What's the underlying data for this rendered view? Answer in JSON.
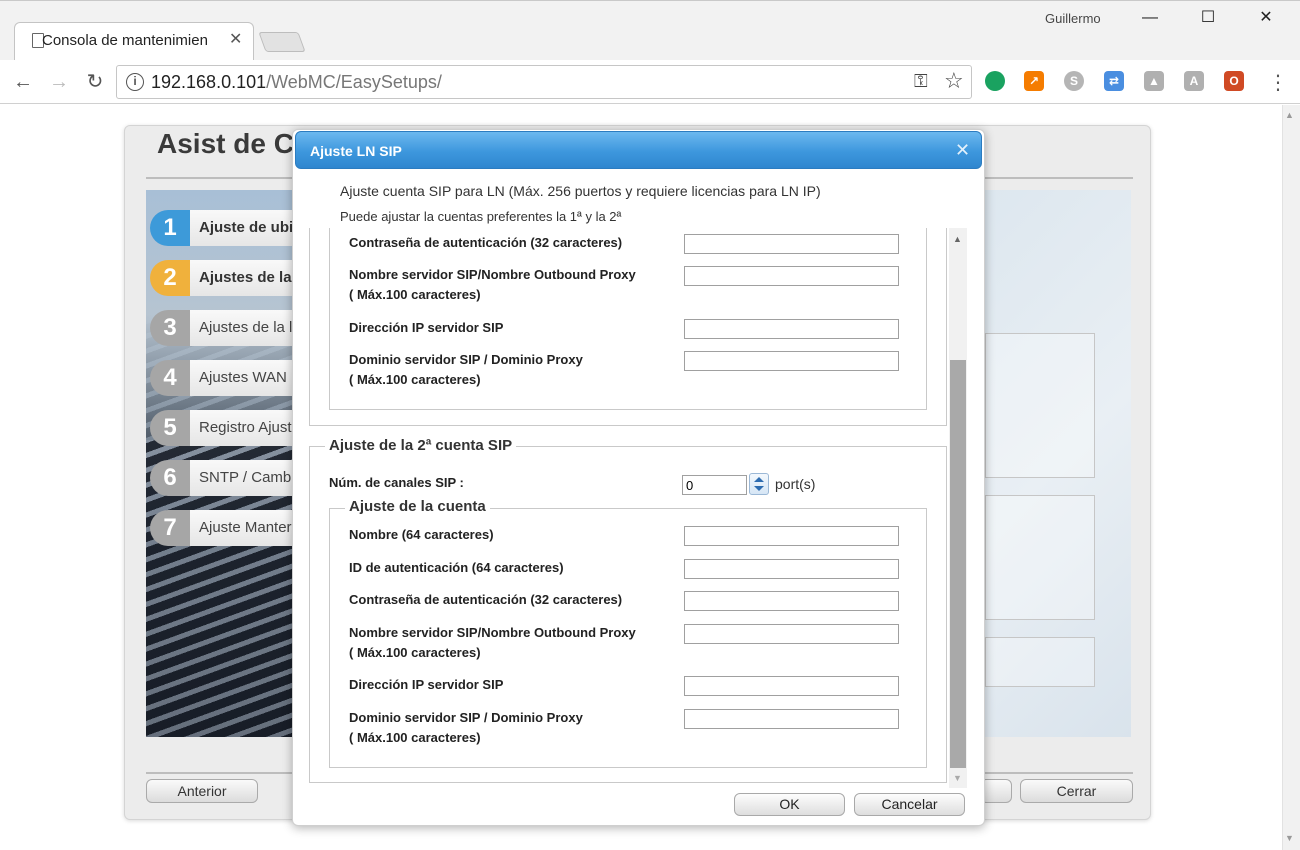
{
  "browser": {
    "tab_title": "Consola de mantenimien",
    "user": "Guillermo",
    "url_host": "192.168.0.101",
    "url_path": "/WebMC/EasySetups/",
    "window_controls": {
      "minimize": "—",
      "maximize": "☐",
      "close": "✕"
    }
  },
  "wizard": {
    "title": "Asist de C",
    "steps": [
      {
        "num": "1",
        "label": "Ajuste de ubi",
        "color": "#3d9ad9",
        "bold": true
      },
      {
        "num": "2",
        "label": "Ajustes de la",
        "color": "#f0b13c",
        "bold": true
      },
      {
        "num": "3",
        "label": "Ajustes de la l",
        "color": "#a6a6a6",
        "bold": false
      },
      {
        "num": "4",
        "label": "Ajustes WAN",
        "color": "#a6a6a6",
        "bold": false
      },
      {
        "num": "5",
        "label": "Registro Ajust",
        "color": "#a6a6a6",
        "bold": false
      },
      {
        "num": "6",
        "label": "SNTP / Camb",
        "color": "#a6a6a6",
        "bold": false
      },
      {
        "num": "7",
        "label": "Ajuste Manter",
        "color": "#a6a6a6",
        "bold": false
      }
    ],
    "buttons": {
      "prev": "Anterior",
      "close": "Cerrar"
    }
  },
  "dialog": {
    "title": "Ajuste LN SIP",
    "desc1": "Ajuste cuenta SIP para LN (Máx. 256 puertos y requiere licencias para LN IP)",
    "desc2": "Puede ajustar la cuentas preferentes la 1ª y la 2ª",
    "account1": {
      "password_label": "Contraseña de autenticación (32 caracteres)",
      "server_label_1": "Nombre servidor SIP/Nombre Outbound Proxy",
      "server_label_2": "( Máx.100 caracteres)",
      "ip_label": "Dirección IP servidor SIP",
      "domain_label_1": "Dominio servidor SIP / Dominio Proxy",
      "domain_label_2": "( Máx.100 caracteres)"
    },
    "account2": {
      "legend": "Ajuste de la 2ª cuenta SIP",
      "channels_label": "Núm. de canales SIP :",
      "channels_value": "0",
      "ports_unit": "port(s)",
      "sub_legend": "Ajuste de la cuenta",
      "name_label": "Nombre (64 caracteres)",
      "auth_id_label": "ID de autenticación (64 caracteres)",
      "password_label": "Contraseña de autenticación (32 caracteres)",
      "server_label_1": "Nombre servidor SIP/Nombre Outbound Proxy",
      "server_label_2": "( Máx.100 caracteres)",
      "ip_label": "Dirección IP servidor SIP",
      "domain_label_1": "Dominio servidor SIP / Dominio Proxy",
      "domain_label_2": "( Máx.100 caracteres)"
    },
    "buttons": {
      "ok": "OK",
      "cancel": "Cancelar"
    }
  }
}
